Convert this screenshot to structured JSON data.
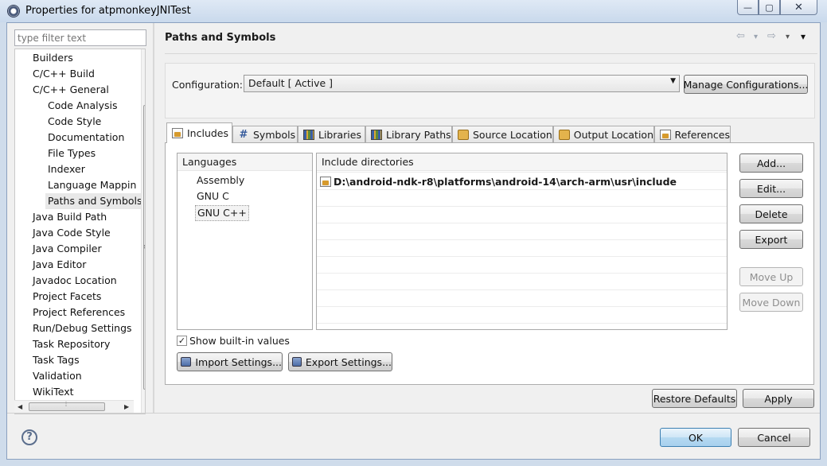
{
  "window": {
    "title": "Properties for atpmonkeyJNITest",
    "minimize_icon": "—",
    "maximize_icon": "▢",
    "close_icon": "✕"
  },
  "sidebar": {
    "filter_placeholder": "type filter text",
    "items": [
      {
        "label": "Builders",
        "level": 1
      },
      {
        "label": "C/C++ Build",
        "level": 1
      },
      {
        "label": "C/C++ General",
        "level": 1
      },
      {
        "label": "Code Analysis",
        "level": 2
      },
      {
        "label": "Code Style",
        "level": 2
      },
      {
        "label": "Documentation",
        "level": 2
      },
      {
        "label": "File Types",
        "level": 2
      },
      {
        "label": "Indexer",
        "level": 2
      },
      {
        "label": "Language Mappin",
        "level": 2
      },
      {
        "label": "Paths and Symbols",
        "level": 2,
        "selected": true
      },
      {
        "label": "Java Build Path",
        "level": 1
      },
      {
        "label": "Java Code Style",
        "level": 1
      },
      {
        "label": "Java Compiler",
        "level": 1
      },
      {
        "label": "Java Editor",
        "level": 1
      },
      {
        "label": "Javadoc Location",
        "level": 1
      },
      {
        "label": "Project Facets",
        "level": 1
      },
      {
        "label": "Project References",
        "level": 1
      },
      {
        "label": "Run/Debug Settings",
        "level": 1
      },
      {
        "label": "Task Repository",
        "level": 1
      },
      {
        "label": "Task Tags",
        "level": 1
      },
      {
        "label": "Validation",
        "level": 1
      },
      {
        "label": "WikiText",
        "level": 1
      }
    ]
  },
  "page": {
    "title": "Paths and Symbols",
    "nav_back": "⇦",
    "nav_forward": "⇨",
    "nav_menu": "▾"
  },
  "configuration": {
    "label": "Configuration:",
    "value": "Default  [ Active ]",
    "manage_label": "Manage Configurations..."
  },
  "tabs": [
    {
      "label": "Includes",
      "icon": "include-icon",
      "active": true
    },
    {
      "label": "Symbols",
      "icon": "hash-icon"
    },
    {
      "label": "Libraries",
      "icon": "library-icon"
    },
    {
      "label": "Library Paths",
      "icon": "library-path-icon"
    },
    {
      "label": "Source Location",
      "icon": "folder-icon"
    },
    {
      "label": "Output Location",
      "icon": "folder-icon"
    },
    {
      "label": "References",
      "icon": "references-icon"
    }
  ],
  "languages": {
    "header": "Languages",
    "items": [
      "Assembly",
      "GNU C",
      "GNU C++"
    ],
    "selected": "GNU C++"
  },
  "include_dirs": {
    "header": "Include directories",
    "items": [
      "D:\\android-ndk-r8\\platforms\\android-14\\arch-arm\\usr\\include"
    ]
  },
  "side_buttons": {
    "add": "Add...",
    "edit": "Edit...",
    "delete": "Delete",
    "export": "Export",
    "move_up": "Move Up",
    "move_down": "Move Down"
  },
  "show_builtin": {
    "label": "Show built-in values",
    "checked": true,
    "mark": "✓"
  },
  "import_settings": "Import Settings...",
  "export_settings": "Export Settings...",
  "restore_defaults": "Restore Defaults",
  "apply": "Apply",
  "ok": "OK",
  "cancel": "Cancel",
  "help": "?"
}
